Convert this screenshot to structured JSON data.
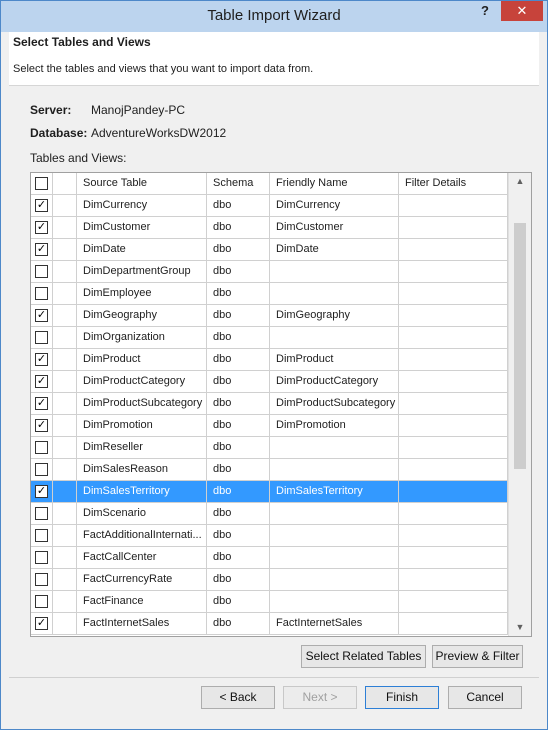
{
  "window": {
    "title": "Table Import Wizard",
    "help": "?",
    "close": "✕"
  },
  "header": {
    "title": "Select Tables and Views",
    "description": "Select the tables and views that you want to import data from."
  },
  "info": {
    "server_label": "Server:",
    "server_value": "ManojPandey-PC",
    "database_label": "Database:",
    "database_value": "AdventureWorksDW2012",
    "tables_label": "Tables and Views:"
  },
  "grid": {
    "columns": [
      "Source Table",
      "Schema",
      "Friendly Name",
      "Filter Details"
    ],
    "rows": [
      {
        "checked": true,
        "source": "DimCurrency",
        "schema": "dbo",
        "friendly": "DimCurrency",
        "filter": ""
      },
      {
        "checked": true,
        "source": "DimCustomer",
        "schema": "dbo",
        "friendly": "DimCustomer",
        "filter": ""
      },
      {
        "checked": true,
        "source": "DimDate",
        "schema": "dbo",
        "friendly": "DimDate",
        "filter": ""
      },
      {
        "checked": false,
        "source": "DimDepartmentGroup",
        "schema": "dbo",
        "friendly": "",
        "filter": ""
      },
      {
        "checked": false,
        "source": "DimEmployee",
        "schema": "dbo",
        "friendly": "",
        "filter": ""
      },
      {
        "checked": true,
        "source": "DimGeography",
        "schema": "dbo",
        "friendly": "DimGeography",
        "filter": ""
      },
      {
        "checked": false,
        "source": "DimOrganization",
        "schema": "dbo",
        "friendly": "",
        "filter": ""
      },
      {
        "checked": true,
        "source": "DimProduct",
        "schema": "dbo",
        "friendly": "DimProduct",
        "filter": ""
      },
      {
        "checked": true,
        "source": "DimProductCategory",
        "schema": "dbo",
        "friendly": "DimProductCategory",
        "filter": ""
      },
      {
        "checked": true,
        "source": "DimProductSubcategory",
        "schema": "dbo",
        "friendly": "DimProductSubcategory",
        "filter": ""
      },
      {
        "checked": true,
        "source": "DimPromotion",
        "schema": "dbo",
        "friendly": "DimPromotion",
        "filter": ""
      },
      {
        "checked": false,
        "source": "DimReseller",
        "schema": "dbo",
        "friendly": "",
        "filter": ""
      },
      {
        "checked": false,
        "source": "DimSalesReason",
        "schema": "dbo",
        "friendly": "",
        "filter": ""
      },
      {
        "checked": true,
        "source": "DimSalesTerritory",
        "schema": "dbo",
        "friendly": "DimSalesTerritory",
        "filter": "",
        "selected": true
      },
      {
        "checked": false,
        "source": "DimScenario",
        "schema": "dbo",
        "friendly": "",
        "filter": ""
      },
      {
        "checked": false,
        "source": "FactAdditionalInternati...",
        "schema": "dbo",
        "friendly": "",
        "filter": ""
      },
      {
        "checked": false,
        "source": "FactCallCenter",
        "schema": "dbo",
        "friendly": "",
        "filter": ""
      },
      {
        "checked": false,
        "source": "FactCurrencyRate",
        "schema": "dbo",
        "friendly": "",
        "filter": ""
      },
      {
        "checked": false,
        "source": "FactFinance",
        "schema": "dbo",
        "friendly": "",
        "filter": ""
      },
      {
        "checked": true,
        "source": "FactInternetSales",
        "schema": "dbo",
        "friendly": "FactInternetSales",
        "filter": ""
      }
    ]
  },
  "buttons": {
    "select_related": "Select Related Tables",
    "preview_filter": "Preview & Filter",
    "back": "< Back",
    "next": "Next >",
    "finish": "Finish",
    "cancel": "Cancel"
  },
  "colors": {
    "selection": "#3399ff",
    "close_button": "#c7433b",
    "titlebar": "#bcd4ee"
  }
}
